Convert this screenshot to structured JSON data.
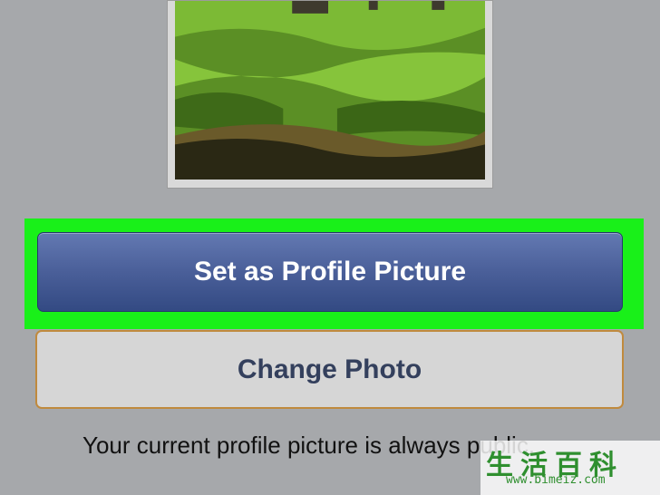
{
  "photo": {
    "description_icon": "profile-photo-preview"
  },
  "buttons": {
    "set_profile": "Set as Profile Picture",
    "change_photo": "Change Photo"
  },
  "info": {
    "text": "Your current profile picture is always public."
  },
  "watermark": {
    "chars": "生活百科",
    "url": "www.bimeiz.com"
  },
  "colors": {
    "background": "#a6a8ab",
    "highlight": "#19f019",
    "primary": "#4a5f99",
    "secondary_border": "#c08a3e"
  }
}
